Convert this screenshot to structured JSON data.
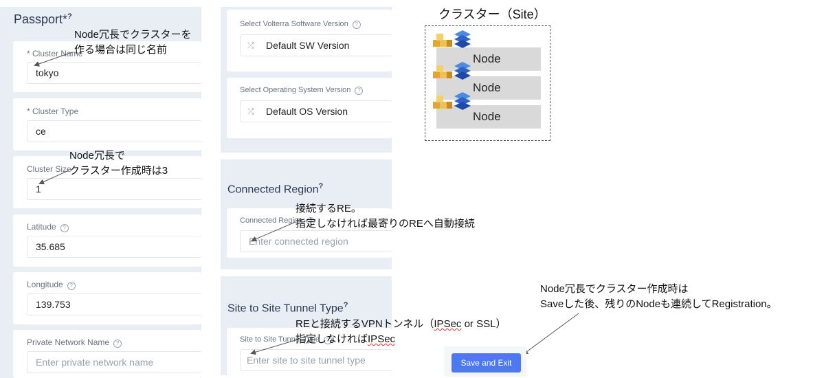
{
  "passport": {
    "title": "Passport",
    "required_mark": "*",
    "title_help": "?",
    "fields": [
      {
        "label": "* Cluster Name",
        "value": "tokyo"
      },
      {
        "label": "* Cluster Type",
        "value": "ce"
      },
      {
        "label": "Cluster Size",
        "value": "1"
      },
      {
        "label": "Latitude",
        "value": "35.685"
      },
      {
        "label": "Longitude",
        "value": "139.753"
      },
      {
        "label": "Private Network Name",
        "placeholder": "Enter private network name"
      }
    ]
  },
  "software": {
    "sw_label": "Select Volterra Software Version",
    "sw_value": "Default SW Version",
    "os_label": "Select Operating System Version",
    "os_value": "Default OS Version"
  },
  "connected_region": {
    "title": "Connected Region",
    "title_help": "?",
    "label": "Connected Region",
    "placeholder": "Enter connected region"
  },
  "tunnel": {
    "title": "Site to Site Tunnel Type",
    "title_help": "?",
    "label": "Site to Site Tunnel Type",
    "placeholder": "Enter site to site tunnel type"
  },
  "annotations": {
    "cluster_name_1": "Node冗長でクラスターを",
    "cluster_name_2": "作る場合は同じ名前",
    "cluster_size_1": "Node冗長で",
    "cluster_size_2": "クラスター作成時は3",
    "region_1": "接続するRE。",
    "region_2": "指定しなければ最寄りのREへ自動接続",
    "tunnel_1a": "REと接続するVPNトンネル（",
    "tunnel_1b": "IPSec",
    "tunnel_1c": " or SSL）",
    "tunnel_2a": "指定しなければ",
    "tunnel_2b": "IPSec",
    "save_1": "Node冗長でクラスター作成時は",
    "save_2": "Saveした後、残りのNodeも連続してRegistration。"
  },
  "diagram": {
    "title": "クラスター（Site）",
    "nodes": [
      "Node",
      "Node",
      "Node"
    ]
  },
  "save_button": "Save and Exit",
  "colors": {
    "accent": "#4d79f0",
    "panel": "#e9edf4"
  }
}
